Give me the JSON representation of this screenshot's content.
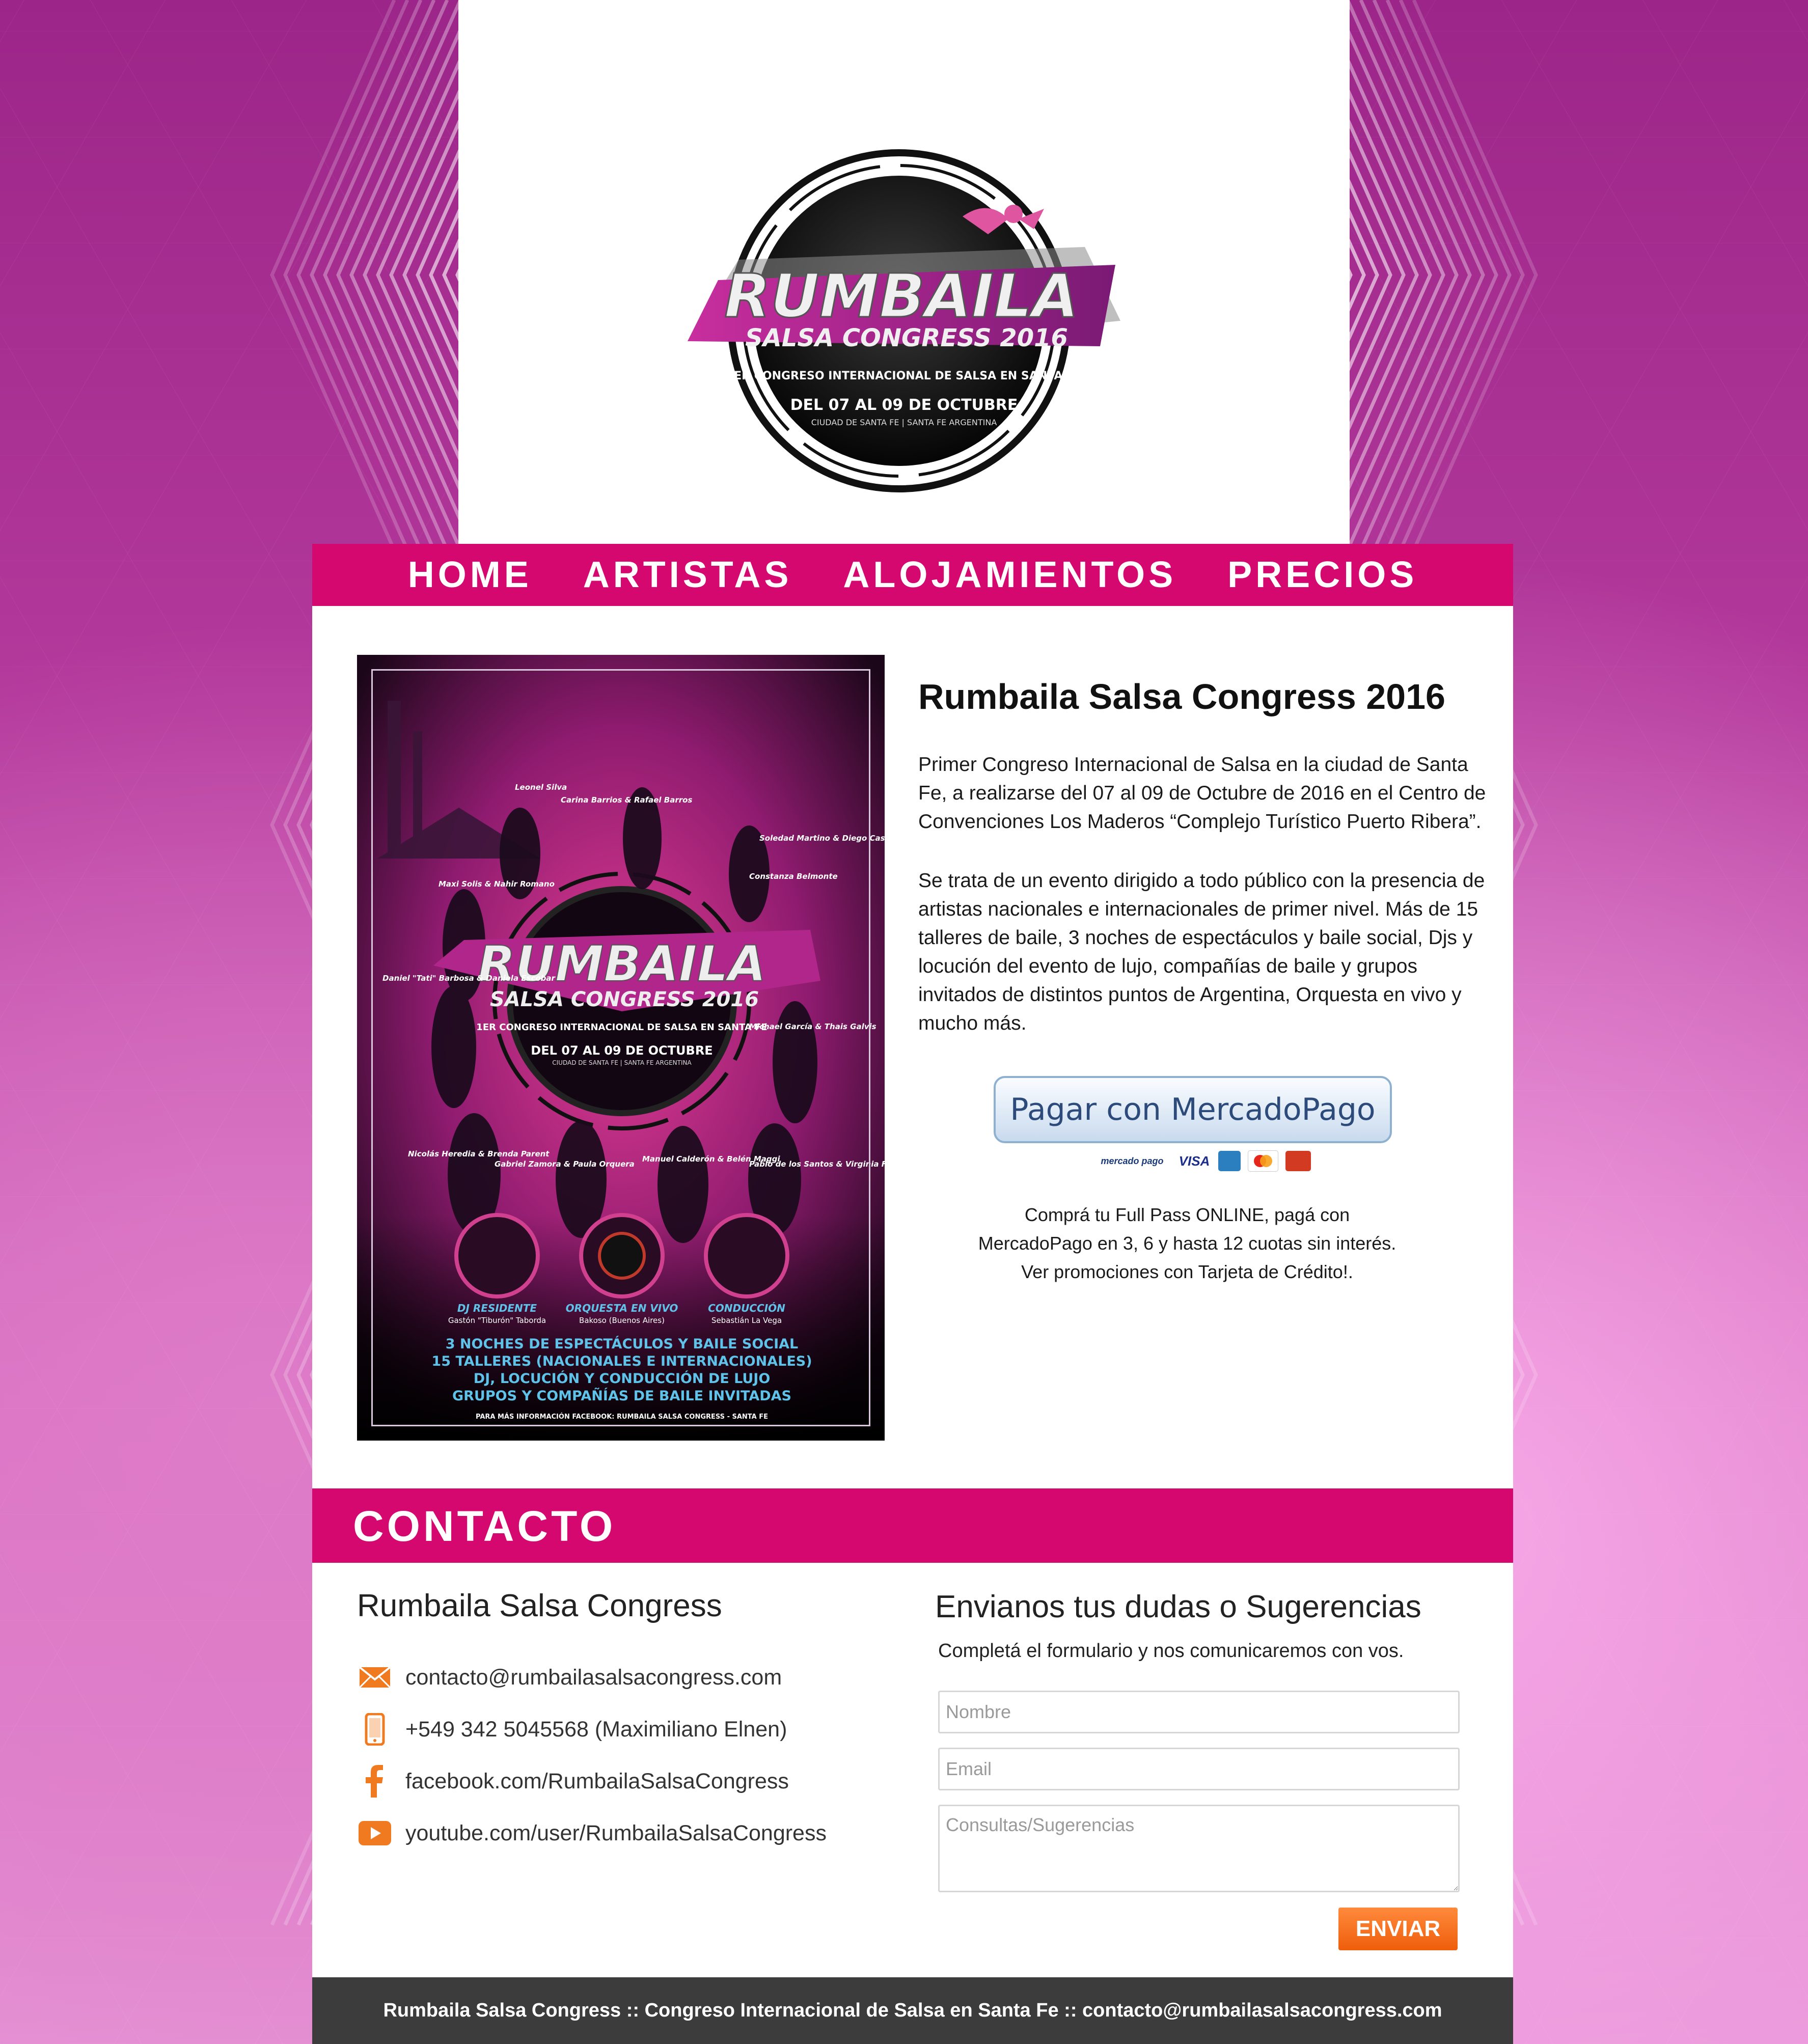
{
  "logo": {
    "brand": "RUMBAILA",
    "subtitle": "SALSA CONGRESS 2016",
    "tagline": "1ER CONGRESO INTERNACIONAL DE SALSA EN SANTA FE",
    "dates": "DEL 07 AL 09 DE OCTUBRE",
    "place": "CIUDAD DE SANTA FE | SANTA FE ARGENTINA"
  },
  "nav": {
    "items": [
      {
        "label": "HOME"
      },
      {
        "label": "ARTISTAS"
      },
      {
        "label": "ALOJAMIENTOS"
      },
      {
        "label": "PRECIOS"
      }
    ]
  },
  "poster": {
    "artists": [
      "Leonel Silva",
      "Carina Barrios & Rafael Barros",
      "Soledad Martino & Diego Castro",
      "Maxi Solis & Nahir Romano",
      "Constanza Belmonte",
      "Daniel \"Tati\" Barbosa & Daniela Escobar",
      "Michael García & Thais Galvis",
      "Nicolás Heredia & Brenda Parent",
      "Gabriel Zamora & Paula Orquera",
      "Manuel Calderón & Belén Maggi",
      "Pablo de los Santos & Virginia Fernández"
    ],
    "roles": [
      {
        "title": "DJ RESIDENTE",
        "name": "Gastón \"Tiburón\" Taborda"
      },
      {
        "title": "ORQUESTA EN VIVO",
        "name": "Bakoso (Buenos Aires)"
      },
      {
        "title": "CONDUCCIÓN",
        "name": "Sebastián La Vega"
      }
    ],
    "features": [
      "3 NOCHES DE ESPECTÁCULOS Y BAILE SOCIAL",
      "15 TALLERES (NACIONALES E INTERNACIONALES)",
      "DJ, LOCUCIÓN Y CONDUCCIÓN DE LUJO",
      "GRUPOS Y COMPAÑÍAS DE BAILE INVITADAS"
    ],
    "more_info": "PARA MÁS INFORMACIÓN FACEBOOK: RUMBAILA SALSA CONGRESS - SANTA FE"
  },
  "article": {
    "title": "Rumbaila Salsa Congress 2016",
    "p1": "Primer Congreso Internacional de Salsa en la ciudad de Santa Fe, a realizarse del 07 al 09 de Octubre de 2016 en el Centro de Convenciones Los Maderos  “Complejo Turístico Puerto Ribera”.",
    "p2": "Se trata de un evento dirigido a todo público con la presencia de artistas nacionales e internacionales de primer nivel. Más de 15 talleres de baile, 3 noches de espectáculos y baile social, Djs y locución del evento de lujo, compañías de baile y grupos invitados de distintos puntos de Argentina, Orquesta en vivo y mucho más."
  },
  "payment": {
    "button_label": "Pagar con MercadoPago",
    "logos": [
      "mercado pago",
      "VISA"
    ],
    "note1": "Comprá tu Full Pass ONLINE, pagá con",
    "note2": "MercadoPago en 3, 6 y hasta 12 cuotas sin interés.",
    "note3": "Ver promociones con Tarjeta de Crédito!."
  },
  "contact": {
    "heading": "CONTACTO",
    "left_title": "Rumbaila Salsa Congress",
    "email": "contacto@rumbailasalsacongress.com",
    "phone": "+549 342 5045568 (Maximiliano Elnen)",
    "facebook": "facebook.com/RumbailaSalsaCongress",
    "youtube": "youtube.com/user/RumbailaSalsaCongress",
    "form_title": "Envianos tus dudas o Sugerencias",
    "form_sub": "Completá el formulario y nos comunicaremos con vos.",
    "name_placeholder": "Nombre",
    "email_placeholder": "Email",
    "message_placeholder": "Consultas/Sugerencias",
    "submit_label": "ENVIAR"
  },
  "footer": {
    "text": "Rumbaila Salsa Congress :: Congreso Internacional de Salsa en Santa Fe :: contacto@rumbailasalsacongress.com"
  },
  "colors": {
    "accent": "#d4086e",
    "footer": "#3c3c3c",
    "submit": "#f26a16"
  }
}
